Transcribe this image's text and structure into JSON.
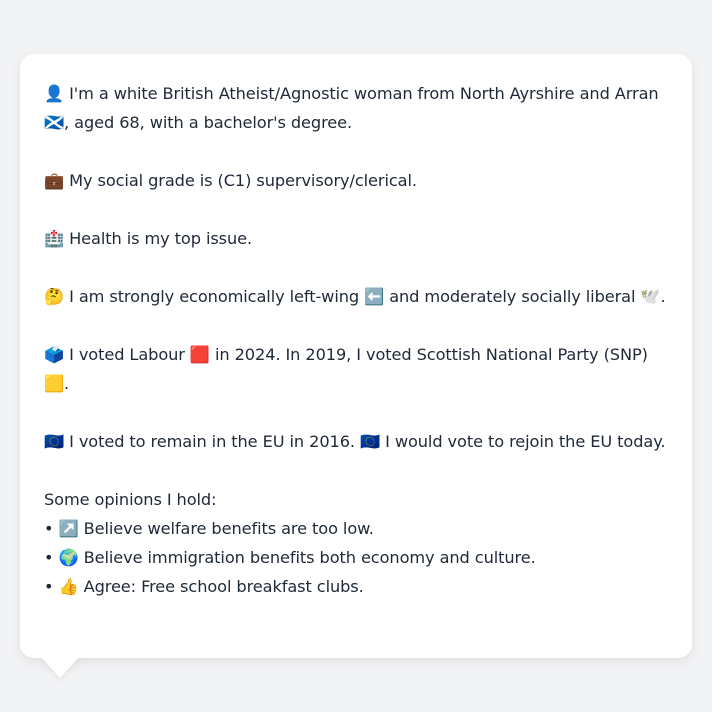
{
  "paragraphs": [
    "👤 I'm a white British Atheist/Agnostic woman from North Ayrshire and Arran 🏴󠁧󠁢󠁳󠁣󠁴󠁿, aged 68, with a bachelor's degree.",
    "💼 My social grade is (C1) supervisory/clerical.",
    "🏥 Health is my top issue.",
    "🤔 I am strongly economically left-wing ⬅️ and moderately socially liberal 🕊️.",
    "🗳️ I voted Labour 🟥 in 2024. In 2019, I voted Scottish National Party (SNP) 🟨.",
    "🇪🇺 I voted to remain in the EU in 2016. 🇪🇺 I would vote to rejoin the EU today."
  ],
  "opinions": {
    "heading": "Some opinions I hold:",
    "items": [
      "↗️ Believe welfare benefits are too low.",
      "🌍 Believe immigration benefits both economy and culture.",
      "👍 Agree: Free school breakfast clubs."
    ]
  }
}
